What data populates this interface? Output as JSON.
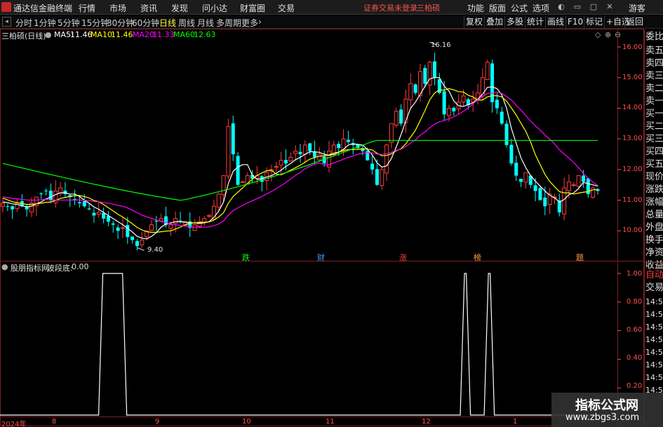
{
  "menubar": {
    "app_name": "通达信金融终端",
    "items": [
      "行情",
      "市场",
      "资讯",
      "发现",
      "问小达",
      "财富圈",
      "交易"
    ],
    "notice": "证券交易未登录",
    "user": "三柏硕",
    "right_items": [
      "功能",
      "版面",
      "公式",
      "选项"
    ],
    "guest": "游客"
  },
  "periodbar": {
    "tabs": [
      "分时",
      "1分钟",
      "5分钟",
      "15分钟",
      "30分钟",
      "60分钟",
      "日线",
      "周线",
      "月线",
      "多周期",
      "更多"
    ],
    "active_tab": "日线",
    "tools": [
      "复权",
      "叠加",
      "多股",
      "统计",
      "画线",
      "F10",
      "标记",
      "+自选",
      "返回"
    ]
  },
  "main_info": {
    "stock": "三柏硕(日线)",
    "ma5_label": "MA5:",
    "ma5": "11.46",
    "ma10_label": "MA10:",
    "ma10": "11.46",
    "ma20_label": "MA20:",
    "ma20": "11.33",
    "ma60_label": "MA60:",
    "ma60": "12.63"
  },
  "price_axis": [
    "16.00",
    "15.00",
    "14.00",
    "13.00",
    "12.00",
    "11.00",
    "10.00"
  ],
  "annotations": {
    "high": "16.16",
    "low": "9.40"
  },
  "signals": [
    "跌",
    "财",
    "涨",
    "榜",
    "题"
  ],
  "sub_info": {
    "indicator": "股朋指标网",
    "name": "波段底:",
    "value": "0.00"
  },
  "sub_axis": [
    "1.00",
    "0.80",
    "0.60",
    "0.40",
    "0.20"
  ],
  "x_axis": [
    "2024年",
    "8",
    "9",
    "10",
    "11",
    "12",
    "1"
  ],
  "side_panel": [
    "委比",
    "卖五",
    "卖四",
    "卖三",
    "卖二",
    "卖一",
    "买一",
    "买二",
    "买三",
    "买四",
    "买五",
    "现价",
    "涨跌",
    "涨幅",
    "总量",
    "外盘",
    "换手",
    "净资",
    "收益"
  ],
  "side_panel_lower": [
    "自动",
    "交易",
    "14:56",
    "14:56",
    "14:56",
    "14:56",
    "14:56",
    "14:56",
    "14:56",
    "14:56"
  ],
  "watermark": {
    "line1": "指标公式网",
    "line2": "www.zbgs3.com"
  },
  "colors": {
    "up": "#ff3c3c",
    "down": "#00ffff",
    "ma5": "#ffffff",
    "ma10": "#ffff00",
    "ma20": "#ff00ff",
    "ma60": "#00ff00",
    "axis": "#ff5050"
  },
  "chart_data": {
    "type": "candlestick",
    "price_range": [
      9.0,
      16.5
    ],
    "closes": [
      10.9,
      10.8,
      10.7,
      10.9,
      10.8,
      10.7,
      10.9,
      11.1,
      11.2,
      11.3,
      11.0,
      11.3,
      11.4,
      11.2,
      11.1,
      11.0,
      10.9,
      10.8,
      10.7,
      10.5,
      10.6,
      10.4,
      10.3,
      10.2,
      10.0,
      10.1,
      9.8,
      9.7,
      9.5,
      9.7,
      10.0,
      10.2,
      10.3,
      10.4,
      10.2,
      10.2,
      10.4,
      10.3,
      10.3,
      10.1,
      10.2,
      10.3,
      10.4,
      10.5,
      10.8,
      11.2,
      11.8,
      13.4,
      12.5,
      11.5,
      11.6,
      11.8,
      11.7,
      11.8,
      11.6,
      11.9,
      12.0,
      12.1,
      12.3,
      12.2,
      12.4,
      12.6,
      12.5,
      12.8,
      12.6,
      12.4,
      12.5,
      12.2,
      12.6,
      12.8,
      12.7,
      13.0,
      12.9,
      12.8,
      12.7,
      12.6,
      12.3,
      12.0,
      11.5,
      12.0,
      12.8,
      13.5,
      13.9,
      13.5,
      14.3,
      14.8,
      14.5,
      15.2,
      14.8,
      15.5,
      15.0,
      14.5,
      13.8,
      14.0,
      13.9,
      14.2,
      14.4,
      14.1,
      14.3,
      14.5,
      15.0,
      15.5,
      14.2,
      14.0,
      13.5,
      12.8,
      12.2,
      11.8,
      11.6,
      11.9,
      11.5,
      11.3,
      11.0,
      10.8,
      11.2,
      11.1,
      10.6,
      11.4,
      11.6,
      11.5,
      11.8,
      11.6,
      11.2,
      11.4,
      11.3
    ],
    "mas": {
      "MA5": {
        "value": 11.46
      },
      "MA10": {
        "value": 11.46
      },
      "MA20": {
        "value": 11.33
      },
      "MA60": {
        "value": 12.63
      }
    },
    "sub_indicator": {
      "name": "波段底",
      "ylim": [
        0,
        1
      ],
      "pulses": [
        [
          0.165,
          0.205
        ],
        [
          0.77,
          0.78
        ],
        [
          0.81,
          0.82
        ]
      ]
    }
  }
}
